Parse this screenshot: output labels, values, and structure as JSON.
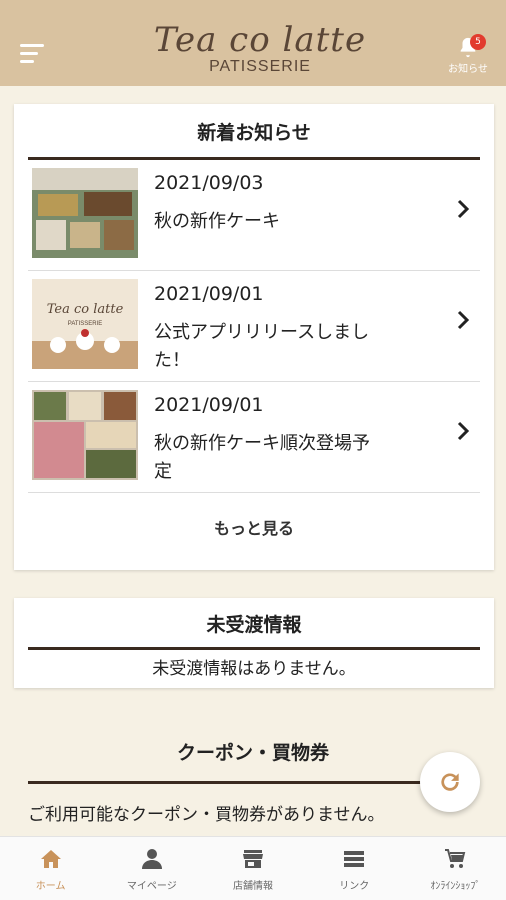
{
  "header": {
    "logo_script": "Tea co latte",
    "logo_sub": "PATISSERIE",
    "notice_label": "お知らせ",
    "notice_badge": "5"
  },
  "news": {
    "title": "新着お知らせ",
    "items": [
      {
        "date": "2021/09/03",
        "text": "秋の新作ケーキ"
      },
      {
        "date": "2021/09/01",
        "text": "公式アプリリリースしました！"
      },
      {
        "date": "2021/09/01",
        "text": "秋の新作ケーキ順次登場予定"
      }
    ],
    "more_label": "もっと見る"
  },
  "untaken": {
    "title": "未受渡情報",
    "text": "未受渡情報はありません。"
  },
  "coupon": {
    "title": "クーポン・買物券",
    "text": "ご利用可能なクーポン・買物券がありません。"
  },
  "tabs": [
    {
      "label": "ホーム",
      "icon": "home-icon"
    },
    {
      "label": "マイページ",
      "icon": "person-icon"
    },
    {
      "label": "店舗情報",
      "icon": "store-icon"
    },
    {
      "label": "リンク",
      "icon": "list-icon"
    },
    {
      "label": "ｵﾝﾗｲﾝｼｮｯﾌﾟ",
      "icon": "cart-icon"
    }
  ],
  "colors": {
    "header": "#d9c2a0",
    "background": "#f6f1e4",
    "accent": "#c8925a",
    "badge": "#e23b2e"
  }
}
